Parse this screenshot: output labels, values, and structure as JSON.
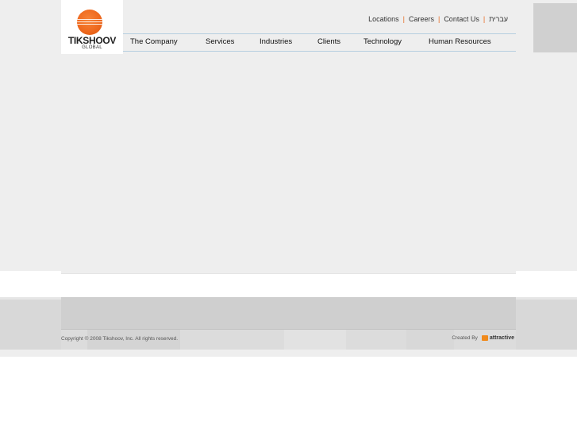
{
  "brand": {
    "name": "TIKSHOOV",
    "tagline": "GLOBAL",
    "accent_color": "#ef6a1f"
  },
  "util_nav": {
    "items": [
      {
        "label": "Locations"
      },
      {
        "label": "Careers"
      },
      {
        "label": "Contact Us"
      },
      {
        "label": "עברית"
      }
    ],
    "separator": "|"
  },
  "main_nav": {
    "items": [
      {
        "label": "The Company"
      },
      {
        "label": "Services"
      },
      {
        "label": "Industries"
      },
      {
        "label": "Clients"
      },
      {
        "label": "Technology"
      },
      {
        "label": "Human Resources"
      }
    ]
  },
  "footer": {
    "copyright": "Copyright © 2008 Tikshoov, Inc. All rights reserved.",
    "created_by": "Created By",
    "creator": "attractive"
  }
}
